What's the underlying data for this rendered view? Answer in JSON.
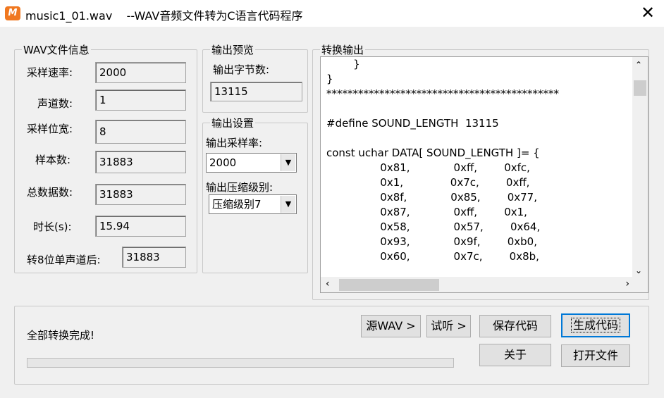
{
  "window": {
    "title": "music1_01.wav    --WAV音频文件转为C语言代码程序",
    "app_icon_text": "M",
    "close_glyph": "✕"
  },
  "wav_info": {
    "group_label": "WAV文件信息",
    "sample_rate_label": "采样速率:",
    "sample_rate": "2000",
    "channels_label": "声道数:",
    "channels": "1",
    "bit_depth_label": "采样位宽:",
    "bit_depth": "8",
    "samples_label": "样本数:",
    "samples": "31883",
    "total_bytes_label": "总数据数:",
    "total_bytes": "31883",
    "duration_label": "时长(s):",
    "duration": "15.94",
    "mono8_label": "转8位单声道后:",
    "mono8": "31883"
  },
  "preview": {
    "group_label": "输出预览",
    "bytes_label": "输出字节数:",
    "bytes": "13115"
  },
  "settings": {
    "group_label": "输出设置",
    "rate_label": "输出采样率:",
    "rate_value": "2000",
    "compress_label": "输出压缩级别:",
    "compress_value": "压缩级别7"
  },
  "output": {
    "group_label": "转换输出",
    "code": "        }\n}\n********************************************\n\n#define SOUND_LENGTH  13115\n\nconst uchar DATA[ SOUND_LENGTH ]= {\n                0x81,             0xff,        0xfc,\n                0x1,              0x7c,        0xff,\n                0x8f,             0x85,        0x77,\n                0x87,             0xff,        0x1,\n                0x58,             0x57,        0x64,\n                0x93,             0x9f,        0xb0,\n                0x60,             0x7c,        0x8b,"
  },
  "status": {
    "text": "全部转换完成!",
    "progress": 0.0
  },
  "buttons": {
    "source_wav": "源WAV >",
    "listen": "试听 >",
    "save_code": "保存代码",
    "generate_code": "生成代码",
    "about": "关于",
    "open_file": "打开文件"
  },
  "icons": {
    "scroll_up": "⌃",
    "scroll_down": "⌄",
    "scroll_left": "‹",
    "scroll_right": "›",
    "dropdown": "▼"
  }
}
